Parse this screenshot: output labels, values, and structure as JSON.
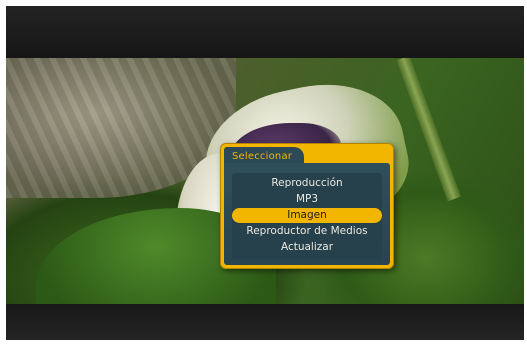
{
  "menu": {
    "title": "Seleccionar",
    "selected_index": 2,
    "items": [
      {
        "label": "Reproducción"
      },
      {
        "label": "MP3"
      },
      {
        "label": "Imagen"
      },
      {
        "label": "Reproductor de Medios"
      },
      {
        "label": "Actualizar"
      }
    ]
  },
  "colors": {
    "accent": "#f2b600",
    "panel": "#2c4a55",
    "text": "#e9e9e2"
  }
}
